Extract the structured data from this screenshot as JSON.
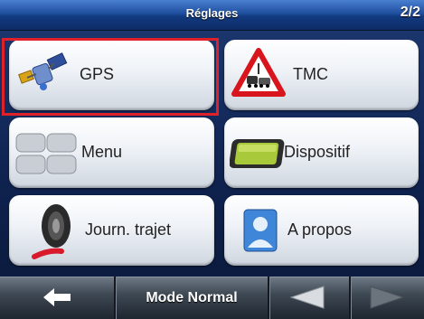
{
  "header": {
    "title": "Réglages",
    "page": "2/2"
  },
  "tiles": [
    {
      "label": "GPS",
      "icon": "gps-satellite-icon",
      "highlighted": true
    },
    {
      "label": "TMC",
      "icon": "tmc-warning-icon"
    },
    {
      "label": "Menu",
      "icon": "menu-icon"
    },
    {
      "label": "Dispositif",
      "icon": "device-icon"
    },
    {
      "label": "Journ. trajet",
      "icon": "trip-log-icon"
    },
    {
      "label": "A propos",
      "icon": "about-icon"
    }
  ],
  "bottom": {
    "back_icon": "back-arrow-icon",
    "mode_label": "Mode Normal",
    "prev_icon": "left-arrow-icon",
    "next_icon": "right-arrow-icon"
  },
  "colors": {
    "highlight": "#e0212a",
    "header_blue": "#1f4f9f"
  }
}
